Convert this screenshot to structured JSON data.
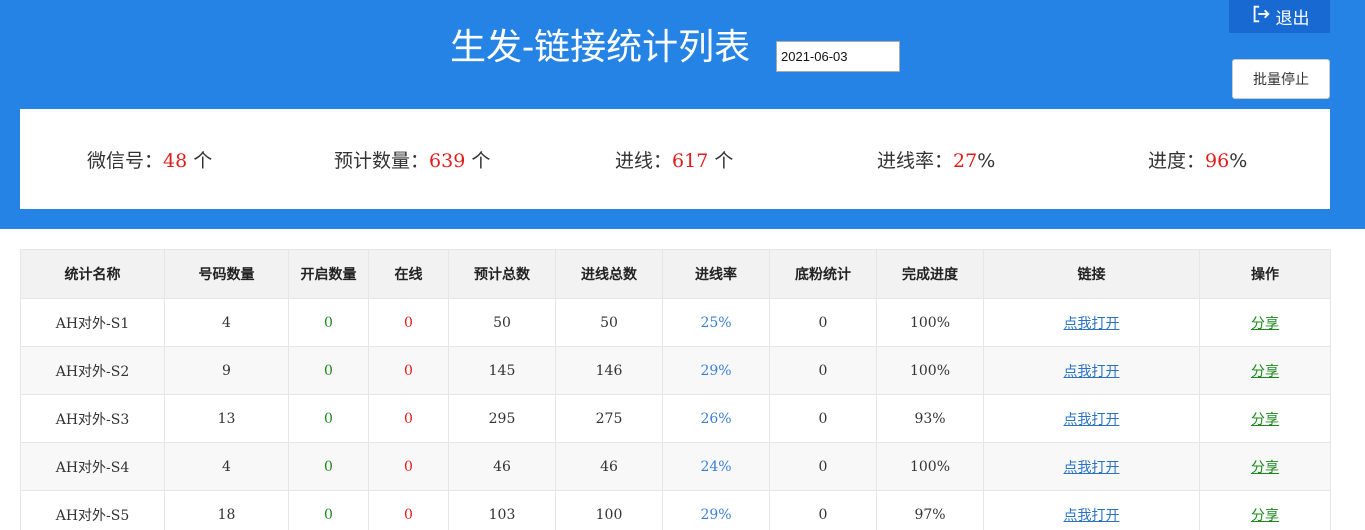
{
  "header": {
    "title": "生发-链接统计列表",
    "date_value": "2021-06-03",
    "logout_label": "退出",
    "batch_stop_label": "批量停止"
  },
  "summary": {
    "wechat": {
      "label": "微信号：",
      "value": "48",
      "unit": " 个"
    },
    "planned": {
      "label": "预计数量：",
      "value": "639",
      "unit": " 个"
    },
    "incoming": {
      "label": "进线：",
      "value": "617",
      "unit": " 个"
    },
    "rate": {
      "label": "进线率：",
      "value": "27",
      "unit": "%"
    },
    "progress": {
      "label": "进度：",
      "value": "96",
      "unit": "%"
    }
  },
  "table": {
    "columns": [
      "统计名称",
      "号码数量",
      "开启数量",
      "在线",
      "预计总数",
      "进线总数",
      "进线率",
      "底粉统计",
      "完成进度",
      "链接",
      "操作"
    ],
    "rows": [
      {
        "name": "AH对外-S1",
        "count": "4",
        "open": "0",
        "online": "0",
        "planned": "50",
        "incoming": "50",
        "rate": "25%",
        "base": "0",
        "done": "100%",
        "link": "点我打开",
        "action": "分享"
      },
      {
        "name": "AH对外-S2",
        "count": "9",
        "open": "0",
        "online": "0",
        "planned": "145",
        "incoming": "146",
        "rate": "29%",
        "base": "0",
        "done": "100%",
        "link": "点我打开",
        "action": "分享"
      },
      {
        "name": "AH对外-S3",
        "count": "13",
        "open": "0",
        "online": "0",
        "planned": "295",
        "incoming": "275",
        "rate": "26%",
        "base": "0",
        "done": "93%",
        "link": "点我打开",
        "action": "分享"
      },
      {
        "name": "AH对外-S4",
        "count": "4",
        "open": "0",
        "online": "0",
        "planned": "46",
        "incoming": "46",
        "rate": "24%",
        "base": "0",
        "done": "100%",
        "link": "点我打开",
        "action": "分享"
      },
      {
        "name": "AH对外-S5",
        "count": "18",
        "open": "0",
        "online": "0",
        "planned": "103",
        "incoming": "100",
        "rate": "29%",
        "base": "0",
        "done": "97%",
        "link": "点我打开",
        "action": "分享"
      }
    ]
  },
  "colors": {
    "header_bg": "#2583e6",
    "accent_red": "#e31b1b",
    "accent_green": "#1a8a1a",
    "link_blue": "#2a73c4"
  },
  "icons": {
    "logout": "logout-icon"
  }
}
